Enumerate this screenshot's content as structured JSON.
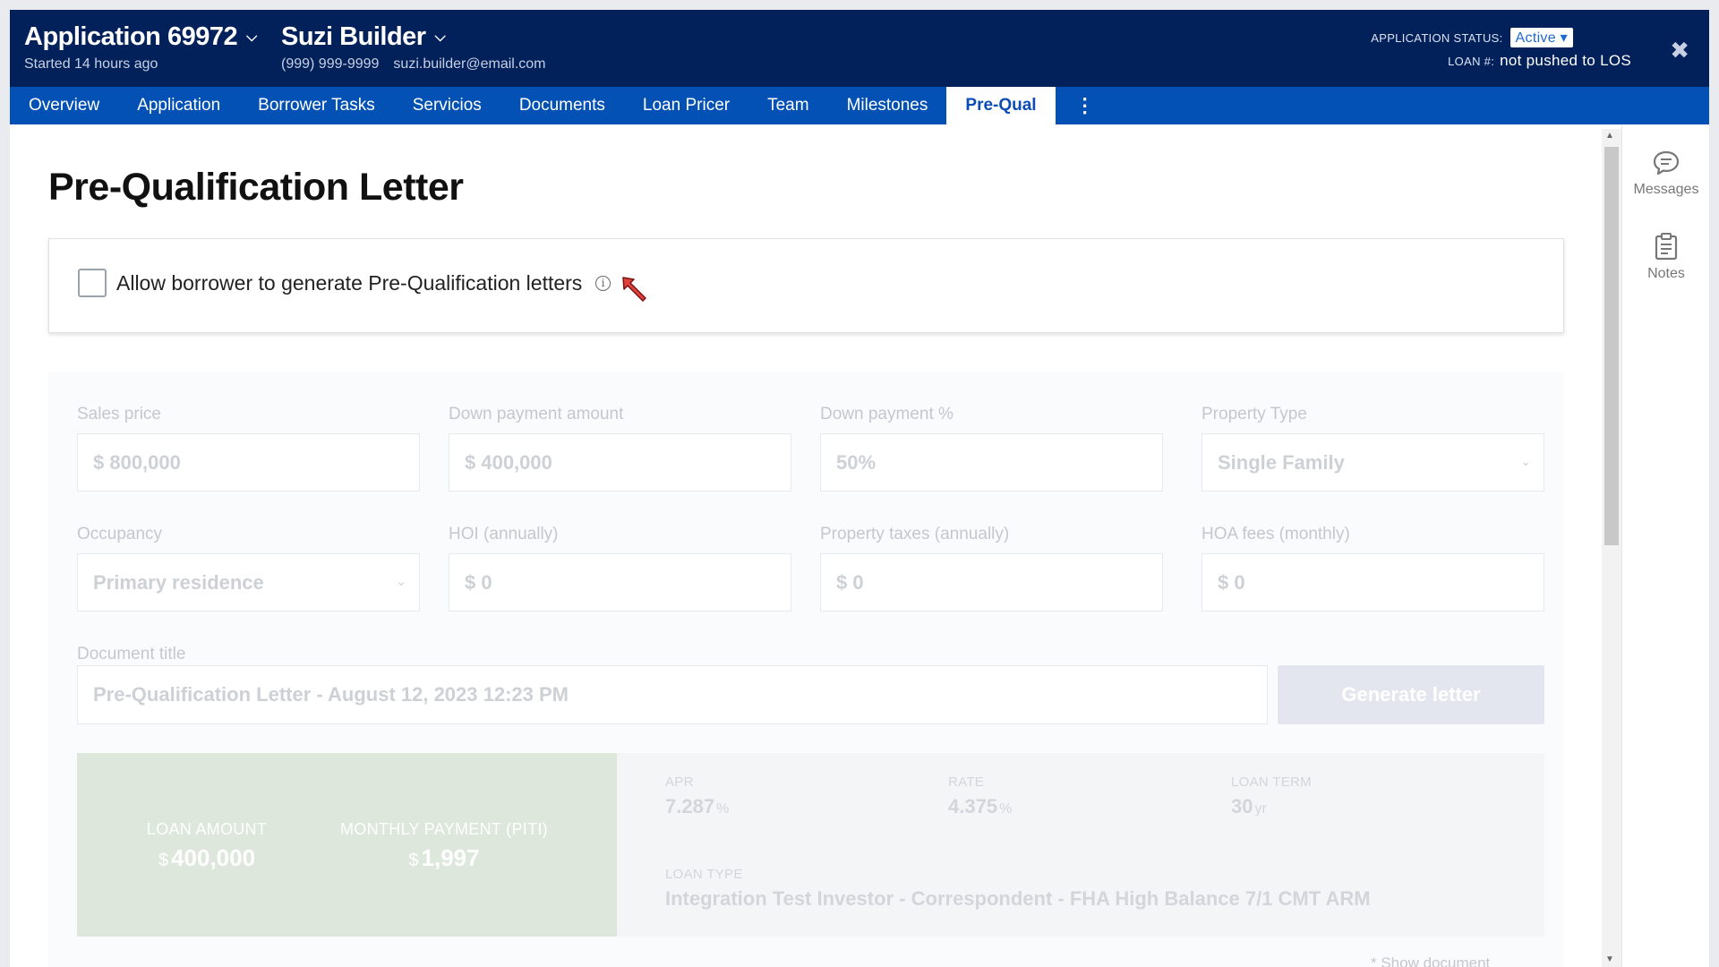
{
  "header": {
    "app_title": "Application 69972",
    "started": "Started 14 hours ago",
    "borrower_name": "Suzi Builder",
    "borrower_phone": "(999) 999-9999",
    "borrower_email": "suzi.builder@email.com",
    "status_label": "APPLICATION STATUS:",
    "status_value": "Active",
    "loan_label": "LOAN #:",
    "loan_value": "not pushed to LOS",
    "close_glyph": "✖"
  },
  "tabs": [
    {
      "label": "Overview"
    },
    {
      "label": "Application"
    },
    {
      "label": "Borrower Tasks"
    },
    {
      "label": "Servicios"
    },
    {
      "label": "Documents"
    },
    {
      "label": "Loan Pricer"
    },
    {
      "label": "Team"
    },
    {
      "label": "Milestones"
    },
    {
      "label": "Pre-Qual",
      "active": true
    }
  ],
  "more_glyph": "⋮",
  "page": {
    "title": "Pre-Qualification Letter",
    "allow_label": "Allow borrower to generate Pre-Qualification letters"
  },
  "form": {
    "sales_price": {
      "label": "Sales price",
      "value": "$ 800,000"
    },
    "down_payment_amount": {
      "label": "Down payment amount",
      "value": "$ 400,000"
    },
    "down_payment_pct": {
      "label": "Down payment %",
      "value": "50%"
    },
    "property_type": {
      "label": "Property Type",
      "value": "Single Family"
    },
    "occupancy": {
      "label": "Occupancy",
      "value": "Primary residence"
    },
    "hoi": {
      "label": "HOI (annually)",
      "value": "$ 0"
    },
    "property_taxes": {
      "label": "Property taxes (annually)",
      "value": "$ 0"
    },
    "hoa_fees": {
      "label": "HOA fees (monthly)",
      "value": "$ 0"
    },
    "document_title": {
      "label": "Document title",
      "value": "Pre-Qualification Letter - August 12, 2023 12:23 PM"
    },
    "generate_label": "Generate letter"
  },
  "summary": {
    "loan_amount_label": "LOAN AMOUNT",
    "loan_amount_currency": "$",
    "loan_amount": "400,000",
    "monthly_payment_label": "MONTHLY PAYMENT (PITI)",
    "monthly_payment_currency": "$",
    "monthly_payment": "1,997"
  },
  "rates": {
    "apr_label": "APR",
    "apr_value": "7.287",
    "apr_unit": "%",
    "rate_label": "RATE",
    "rate_value": "4.375",
    "rate_unit": "%",
    "term_label": "LOAN TERM",
    "term_value": "30",
    "term_unit": "yr",
    "loan_type_label": "LOAN TYPE",
    "loan_type_value": "Integration Test Investor - Correspondent - FHA High Balance 7/1 CMT ARM"
  },
  "partial_text": "* Show document",
  "rail": {
    "messages": "Messages",
    "notes": "Notes"
  },
  "colors": {
    "header_bg": "#02215a",
    "tabbar_bg": "#0451b5",
    "active_tab_text": "#0b4db5",
    "summary_bg": "#dde7dc",
    "cursor_red": "#e0413b"
  }
}
